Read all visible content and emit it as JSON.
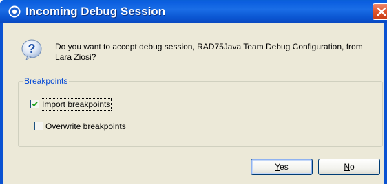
{
  "dialog": {
    "title": "Incoming Debug Session",
    "message": "Do you want to accept debug session, RAD75Java Team Debug Configuration, from Lara Ziosi?",
    "icons": {
      "title_icon": "eclipse-icon",
      "message_icon": "question-icon",
      "close_icon": "close-icon"
    }
  },
  "breakpoints_group": {
    "label": "Breakpoints",
    "import": {
      "label": "Import breakpoints",
      "checked": true
    },
    "overwrite": {
      "label": "Overwrite breakpoints",
      "checked": false
    }
  },
  "buttons": {
    "yes_mnemonic": "Y",
    "yes_rest": "es",
    "no_mnemonic": "N",
    "no_rest": "o"
  },
  "colors": {
    "titlebar": "#0b56d2",
    "client_bg": "#ece9d8",
    "group_label": "#0046d5",
    "close_button": "#e0572f"
  }
}
